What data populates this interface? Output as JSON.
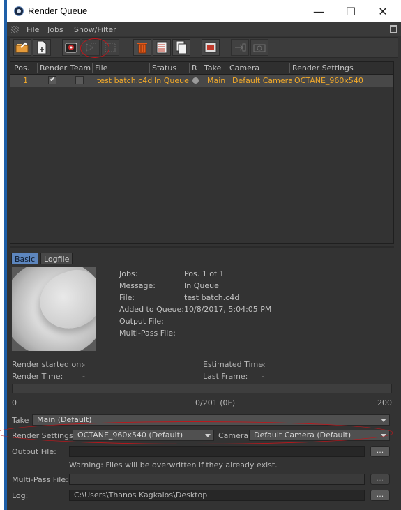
{
  "window": {
    "title": "Render Queue",
    "controls": {
      "minimize": "—",
      "maximize": "☐",
      "close": "✕"
    }
  },
  "menu": {
    "items": [
      "File",
      "Jobs",
      "Show/Filter"
    ]
  },
  "table": {
    "headers": [
      "Pos.",
      "Render",
      "Team",
      "File",
      "Status",
      "R",
      "Take",
      "Camera",
      "Render Settings"
    ],
    "rows": [
      {
        "pos": "1",
        "render_checked": true,
        "team_checked": false,
        "file": "test batch.c4d",
        "status": "In Queue",
        "take": "Main",
        "camera": "Default Camera",
        "render_settings": "OCTANE_960x540"
      }
    ],
    "row_color": "#f1a92a"
  },
  "tabs": [
    {
      "label": "Basic",
      "active": true
    },
    {
      "label": "Logfile",
      "active": false
    }
  ],
  "info": {
    "jobs_label": "Jobs:",
    "jobs_value": "Pos. 1 of 1",
    "message_label": "Message:",
    "message_value": "In Queue",
    "file_label": "File:",
    "file_value": "test batch.c4d",
    "added_label": "Added to Queue:",
    "added_value": "10/8/2017, 5:04:05 PM",
    "output_label": "Output File:",
    "multipass_label": "Multi-Pass File:"
  },
  "status": {
    "render_started_label": "Render started on:",
    "render_started_value": "-",
    "render_time_label": "Render Time:",
    "render_time_value": "-",
    "estimated_label": "Estimated Time:",
    "estimated_value": "-",
    "last_frame_label": "Last Frame:",
    "last_frame_value": "-"
  },
  "progress": {
    "min": "0",
    "current": "0/201 (0F)",
    "max": "200",
    "fraction": 0
  },
  "settings": {
    "take_label": "Take",
    "take_value": "Main (Default)",
    "render_settings_label": "Render Settings",
    "render_settings_value": "OCTANE_960x540 (Default)",
    "camera_label": "Camera",
    "camera_value": "Default Camera (Default)",
    "output_label": "Output File:",
    "output_value": "",
    "warning": "Warning: Files will be overwritten if they already exist.",
    "multipass_label": "Multi-Pass File:",
    "multipass_value": "",
    "log_label": "Log:",
    "log_value": "C:\\Users\\Thanos Kagkalos\\Desktop",
    "browse_label": "..."
  },
  "colors": {
    "accent_tab": "#5d86be",
    "annotation": "#c0161b",
    "title_bar_border": "#1e5fa8"
  }
}
